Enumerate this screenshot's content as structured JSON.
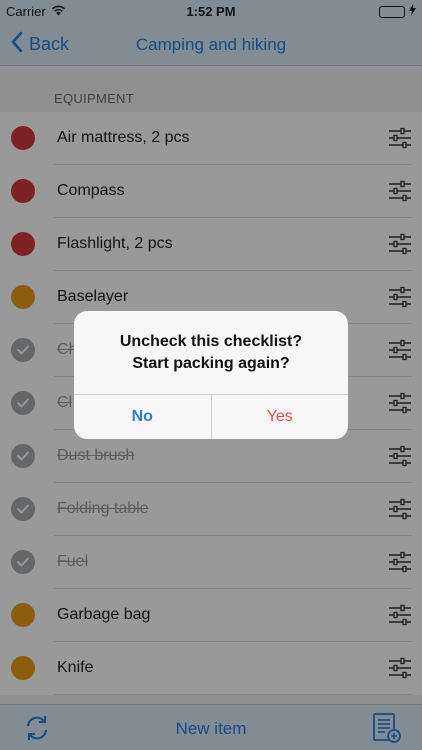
{
  "status": {
    "carrier": "Carrier",
    "time": "1:52 PM"
  },
  "nav": {
    "back_label": "Back",
    "title": "Camping and hiking"
  },
  "section": {
    "header": "EQUIPMENT"
  },
  "items": [
    {
      "label": "Air mattress, 2 pcs",
      "status": "red"
    },
    {
      "label": "Compass",
      "status": "red"
    },
    {
      "label": "Flashlight, 2 pcs",
      "status": "red"
    },
    {
      "label": "Baselayer",
      "status": "orange"
    },
    {
      "label": "Ch",
      "status": "checked"
    },
    {
      "label": "Cl",
      "status": "checked"
    },
    {
      "label": "Dust brush",
      "status": "checked"
    },
    {
      "label": "Folding table",
      "status": "checked"
    },
    {
      "label": "Fuel",
      "status": "checked"
    },
    {
      "label": "Garbage bag",
      "status": "orange"
    },
    {
      "label": "Knife",
      "status": "orange"
    }
  ],
  "toolbar": {
    "new_item_label": "New item"
  },
  "alert": {
    "line1": "Uncheck this checklist?",
    "line2": "Start packing again?",
    "no_label": "No",
    "yes_label": "Yes"
  },
  "colors": {
    "accent": "#2a7dd6",
    "red": "#d23a3d",
    "orange": "#e89b16",
    "checked": "#a9abad",
    "destructive": "#e04b4b"
  }
}
